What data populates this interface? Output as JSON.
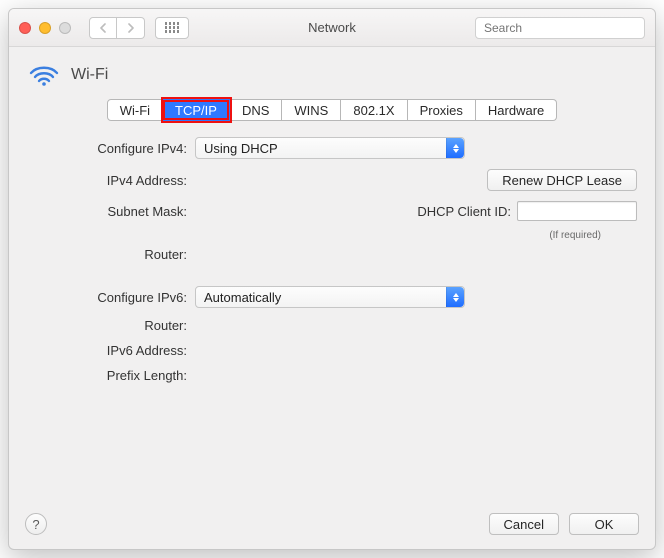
{
  "window": {
    "title": "Network"
  },
  "search": {
    "placeholder": "Search"
  },
  "heading": {
    "icon_name": "wifi-icon",
    "label": "Wi-Fi"
  },
  "tabs": [
    {
      "label": "Wi-Fi",
      "selected": false
    },
    {
      "label": "TCP/IP",
      "selected": true
    },
    {
      "label": "DNS",
      "selected": false
    },
    {
      "label": "WINS",
      "selected": false
    },
    {
      "label": "802.1X",
      "selected": false
    },
    {
      "label": "Proxies",
      "selected": false
    },
    {
      "label": "Hardware",
      "selected": false
    }
  ],
  "ipv4": {
    "configure_label": "Configure IPv4:",
    "configure_value": "Using DHCP",
    "address_label": "IPv4 Address:",
    "address_value": "",
    "subnet_label": "Subnet Mask:",
    "subnet_value": "",
    "router_label": "Router:",
    "router_value": "",
    "renew_label": "Renew DHCP Lease",
    "client_id_label": "DHCP Client ID:",
    "client_id_value": "",
    "required_hint": "(If required)"
  },
  "ipv6": {
    "configure_label": "Configure IPv6:",
    "configure_value": "Automatically",
    "router_label": "Router:",
    "router_value": "",
    "address_label": "IPv6 Address:",
    "address_value": "",
    "prefix_label": "Prefix Length:",
    "prefix_value": ""
  },
  "buttons": {
    "cancel": "Cancel",
    "ok": "OK",
    "help_tooltip": "?"
  },
  "colors": {
    "accent": "#2f79ff",
    "highlight_outline": "#ee1111"
  }
}
